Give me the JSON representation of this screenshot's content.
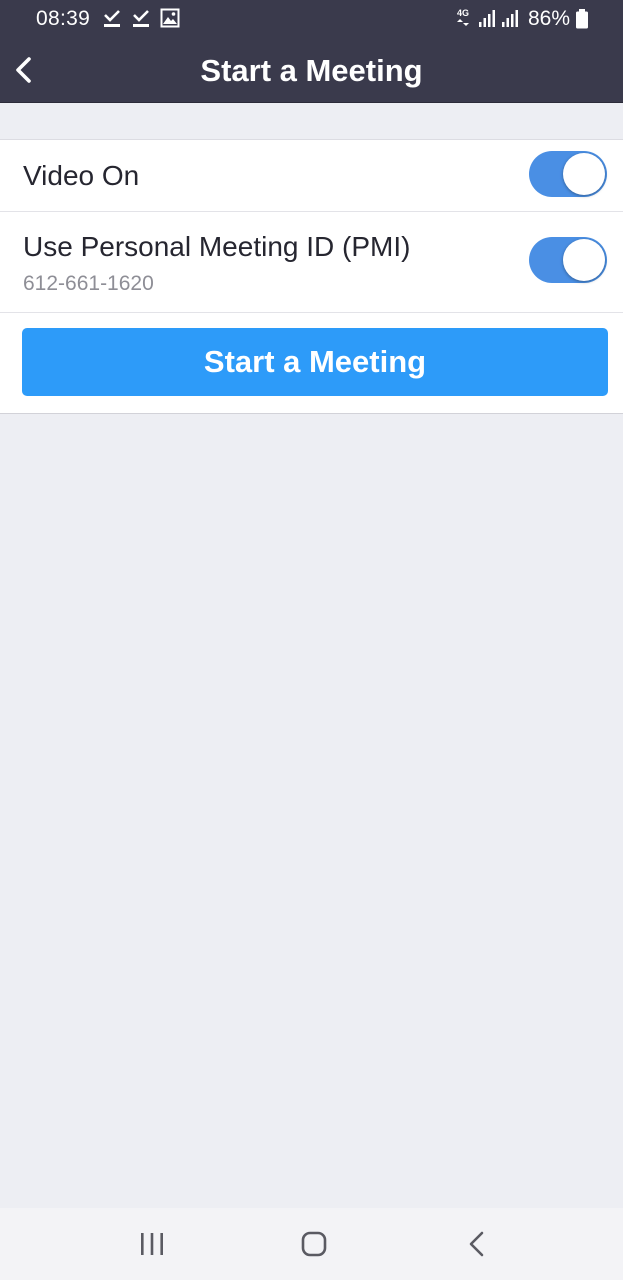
{
  "status_bar": {
    "time": "08:39",
    "network": "4G",
    "battery": "86%",
    "icons": [
      "download-done-icon",
      "download-done-icon",
      "image-icon",
      "network-4g-icon",
      "signal-icon",
      "signal-icon",
      "battery-icon"
    ]
  },
  "app_bar": {
    "title": "Start a Meeting",
    "back_icon": "chevron-left-icon"
  },
  "settings": {
    "video_on": {
      "label": "Video On",
      "enabled": true
    },
    "pmi": {
      "label": "Use Personal Meeting ID (PMI)",
      "meeting_id": "612-661-1620",
      "enabled": true
    }
  },
  "start_button": {
    "label": "Start a Meeting"
  },
  "nav_bar": {
    "items": [
      "recent-apps-icon",
      "home-icon",
      "back-icon"
    ]
  },
  "colors": {
    "header_bg": "#3a3a4c",
    "page_bg": "#edeef3",
    "toggle_on": "#4a8fe4",
    "button_blue": "#2d9bf9"
  }
}
